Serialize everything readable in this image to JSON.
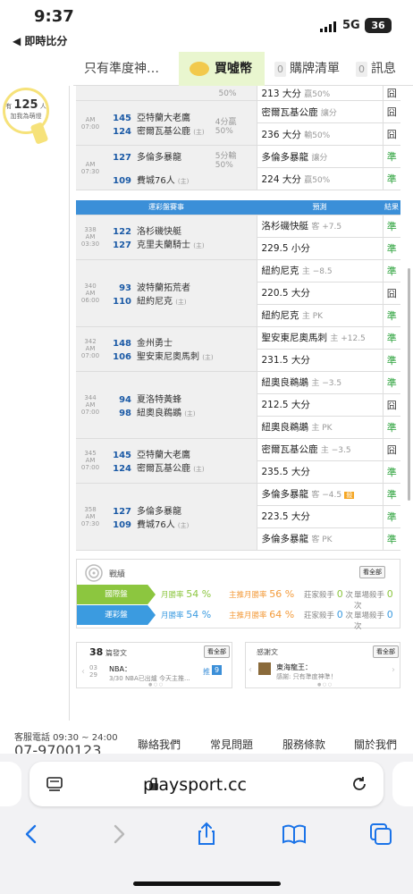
{
  "status": {
    "time": "9:37",
    "back_app": "◀ 即時比分",
    "network": "5G",
    "battery": "36"
  },
  "topnav": {
    "tab1": "只有準度神…",
    "buycoin": "買噓幣",
    "purchases_count": "0",
    "purchases": "購牌清單",
    "messages_count": "0",
    "messages": "訊息"
  },
  "visitors": {
    "prefix": "有",
    "count": "125",
    "suffix": "人",
    "line2": "加我為萌燈"
  },
  "section1_rows": [
    {
      "odds": "50%",
      "pick": "213 大分",
      "sub": "贏50%",
      "result": "囧"
    },
    {
      "time": "AM 07:00",
      "away_num": "145",
      "away": "亞特蘭大老鷹",
      "home_num": "124",
      "home": "密爾瓦基公鹿",
      "line": "4分贏",
      "line2": "50%",
      "pick1": "密爾瓦基公鹿",
      "pick1sub": "讓分",
      "r1": "囧",
      "pick2": "236 大分",
      "pick2sub": "輸50%",
      "r2": "囧"
    },
    {
      "time": "AM 07:30",
      "away_num": "127",
      "away": "多倫多暴龍",
      "home_num": "109",
      "home": "費城76人",
      "line": "5分輸",
      "line2": "50%",
      "pick1": "多倫多暴龍",
      "pick1sub": "讓分",
      "r1": "準",
      "pick2": "224 大分",
      "pick2sub": "贏50%",
      "r2": "準"
    }
  ],
  "section2": {
    "header_game": "運彩盤賽事",
    "header_pick": "預測",
    "header_result": "結果",
    "games": [
      {
        "no": "338",
        "time": "AM 03:30",
        "away_num": "122",
        "away": "洛杉磯快艇",
        "home_num": "127",
        "home": "克里夫蘭騎士",
        "picks": [
          {
            "t": "洛杉磯快艇",
            "s": "客 +7.5",
            "r": "準"
          },
          {
            "t": "229.5 小分",
            "s": "",
            "r": "準"
          }
        ]
      },
      {
        "no": "340",
        "time": "AM 06:00",
        "away_num": "93",
        "away": "波特蘭拓荒者",
        "home_num": "110",
        "home": "紐約尼克",
        "picks": [
          {
            "t": "紐約尼克",
            "s": "主 −8.5",
            "r": "準"
          },
          {
            "t": "220.5 大分",
            "s": "",
            "r": "囧"
          },
          {
            "t": "紐約尼克",
            "s": "主 PK",
            "r": "準"
          }
        ]
      },
      {
        "no": "342",
        "time": "AM 07:00",
        "away_num": "148",
        "away": "金州勇士",
        "home_num": "106",
        "home": "聖安東尼奧馬刺",
        "picks": [
          {
            "t": "聖安東尼奧馬刺",
            "s": "主 +12.5",
            "r": "準"
          },
          {
            "t": "231.5 大分",
            "s": "",
            "r": "準"
          }
        ]
      },
      {
        "no": "344",
        "time": "AM 07:00",
        "away_num": "94",
        "away": "夏洛特黃蜂",
        "home_num": "98",
        "home": "紐奧良鵜鶘",
        "picks": [
          {
            "t": "紐奧良鵜鶘",
            "s": "主 −3.5",
            "r": "準"
          },
          {
            "t": "212.5 大分",
            "s": "",
            "r": "囧"
          },
          {
            "t": "紐奧良鵜鶘",
            "s": "主 PK",
            "r": "準"
          }
        ]
      },
      {
        "no": "345",
        "time": "AM 07:00",
        "away_num": "145",
        "away": "亞特蘭大老鷹",
        "home_num": "124",
        "home": "密爾瓦基公鹿",
        "picks": [
          {
            "t": "密爾瓦基公鹿",
            "s": "主 −3.5",
            "r": "囧"
          },
          {
            "t": "235.5 大分",
            "s": "",
            "r": "準"
          }
        ]
      },
      {
        "no": "358",
        "time": "AM 07:30",
        "away_num": "127",
        "away": "多倫多暴龍",
        "home_num": "109",
        "home": "費城76人",
        "picks": [
          {
            "t": "多倫多暴龍",
            "s": "客 −4.5",
            "r": "準",
            "tag": "殺"
          },
          {
            "t": "223.5 大分",
            "s": "",
            "r": "準"
          },
          {
            "t": "多倫多暴龍",
            "s": "客 PK",
            "r": "準"
          }
        ]
      }
    ],
    "home_marker": "(主)"
  },
  "stats": {
    "title": "戰績",
    "view_all": "看全部",
    "rows": [
      {
        "label": "國際盤",
        "color": "#8cc63f",
        "monthly_label": "月勝率",
        "monthly": "54 %",
        "main_label": "主推月勝率",
        "main": "56 %",
        "banker_label": "莊家殺手",
        "banker": "0",
        "banker_unit": "次",
        "single_label": "單場殺手",
        "single": "0",
        "single_unit": "次"
      },
      {
        "label": "運彩盤",
        "color": "#3b9be0",
        "monthly_label": "月勝率",
        "monthly": "54 %",
        "main_label": "主推月勝率",
        "main": "64 %",
        "banker_label": "莊家殺手",
        "banker": "0",
        "banker_unit": "次",
        "single_label": "單場殺手",
        "single": "0",
        "single_unit": "次"
      }
    ]
  },
  "posts": {
    "count": "38",
    "count_label": "篇發文",
    "view_all": "看全部",
    "date_m": "03",
    "date_d": "29",
    "title": "NBA：",
    "snippet": "3/30 NBA已出爐 今天主推...",
    "tag": "推",
    "tag_count": "9",
    "thanks_title": "感謝文",
    "thanks_view_all": "看全部",
    "thanks_name": "東海龍王：",
    "thanks_snippet": "感謝: 只有準度神準！"
  },
  "footer": {
    "service": "客服電話 09:30 ~ 24:00",
    "phone": "07-9700123",
    "links": [
      "聯絡我們",
      "常見問題",
      "服務條款",
      "關於我們"
    ]
  },
  "browser": {
    "url": "playsport.cc"
  }
}
